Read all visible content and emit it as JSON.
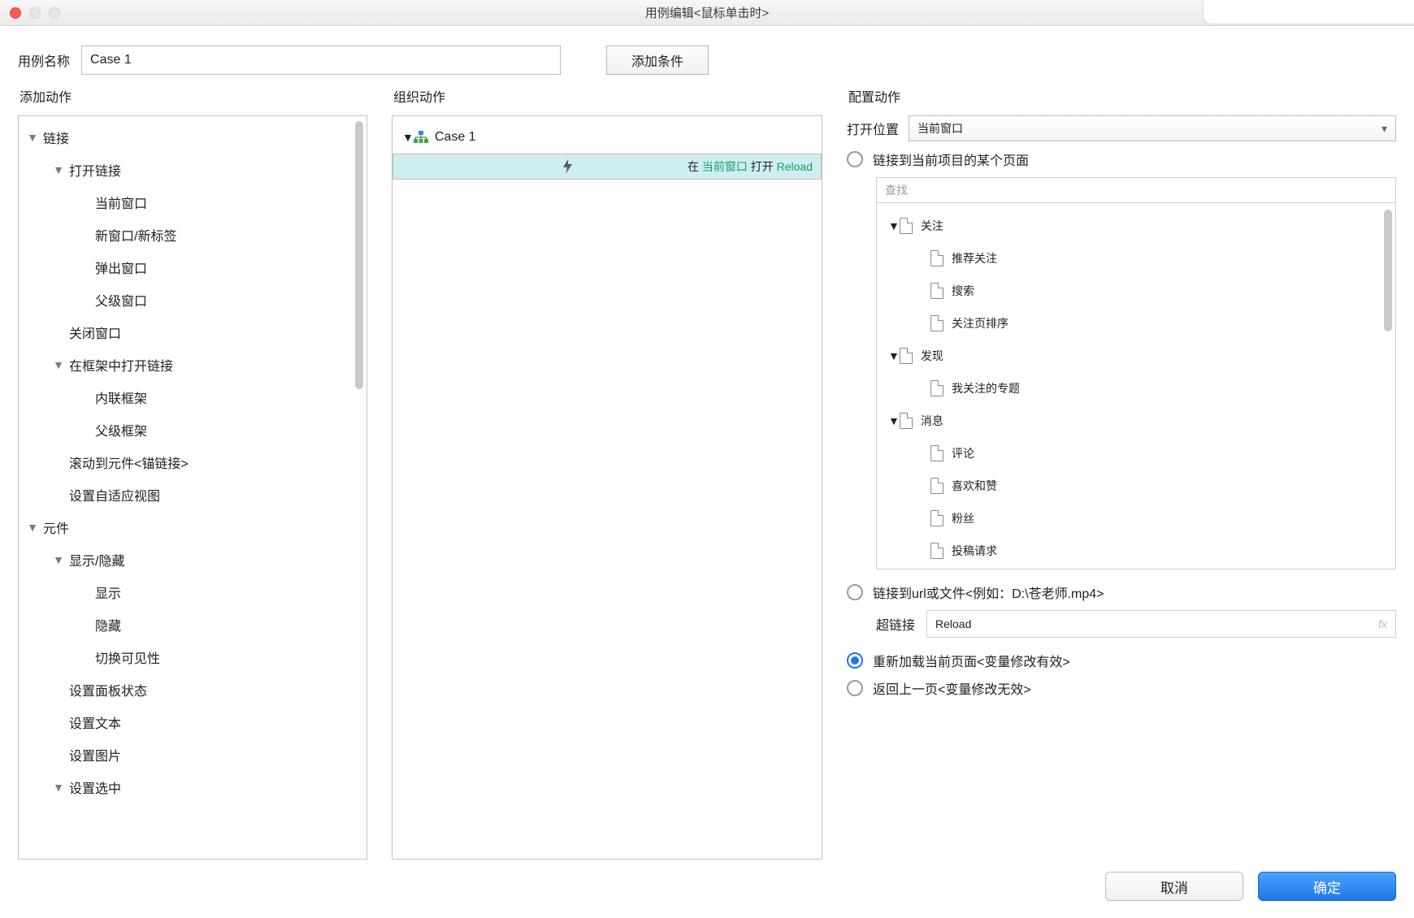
{
  "window": {
    "title": "用例编辑<鼠标单击时>"
  },
  "top": {
    "name_label": "用例名称",
    "name_value": "Case 1",
    "add_condition": "添加条件"
  },
  "columns": {
    "add_action": "添加动作",
    "organize": "组织动作",
    "configure": "配置动作"
  },
  "action_tree": {
    "links": {
      "label": "链接",
      "open_link": {
        "label": "打开链接",
        "items": [
          "当前窗口",
          "新窗口/新标签",
          "弹出窗口",
          "父级窗口"
        ]
      },
      "close_window": "关闭窗口",
      "open_in_frame": {
        "label": "在框架中打开链接",
        "items": [
          "内联框架",
          "父级框架"
        ]
      },
      "scroll_anchor": "滚动到元件<锚链接>",
      "set_adaptive": "设置自适应视图"
    },
    "widgets": {
      "label": "元件",
      "show_hide": {
        "label": "显示/隐藏",
        "items": [
          "显示",
          "隐藏",
          "切换可见性"
        ]
      },
      "panel_state": "设置面板状态",
      "set_text": "设置文本",
      "set_image": "设置图片",
      "set_select": "设置选中"
    }
  },
  "organize": {
    "case_label": "Case 1",
    "action_prefix": "在 ",
    "action_mid": "当前窗口",
    "action_mid2": " 打开 ",
    "action_target": "Reload"
  },
  "configure": {
    "open_in_label": "打开位置",
    "open_in_value": "当前窗口",
    "radio_link_page": "链接到当前项目的某个页面",
    "search_placeholder": "查找",
    "page_tree": [
      {
        "label": "关注",
        "children": [
          "推荐关注",
          "搜索",
          "关注页排序"
        ]
      },
      {
        "label": "发现",
        "children": [
          "我关注的专题"
        ]
      },
      {
        "label": "消息",
        "children": [
          "评论",
          "喜欢和赞",
          "粉丝",
          "投稿请求"
        ]
      }
    ],
    "radio_link_url": "链接到url或文件<例如：D:\\苍老师.mp4>",
    "hyperlink_label": "超链接",
    "hyperlink_value": "Reload",
    "fx": "fx",
    "radio_reload": "重新加载当前页面<变量修改有效>",
    "radio_back": "返回上一页<变量修改无效>"
  },
  "footer": {
    "cancel": "取消",
    "ok": "确定"
  }
}
